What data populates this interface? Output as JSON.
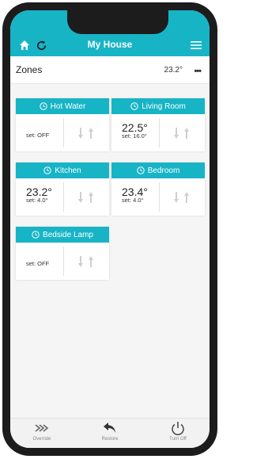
{
  "header": {
    "title": "My House",
    "home_icon": "home-icon",
    "refresh_icon": "refresh-icon",
    "menu_icon": "hamburger-menu-icon",
    "accent_color": "#17b4c6"
  },
  "zones_bar": {
    "label": "Zones",
    "temperature": "23.2°",
    "more_icon": "more-dots-icon"
  },
  "zones": [
    {
      "name": "Hot Water",
      "current": "",
      "set": "set: OFF"
    },
    {
      "name": "Living Room",
      "current": "22.5°",
      "set": "set: 16.0°"
    },
    {
      "name": "Kitchen",
      "current": "23.2°",
      "set": "set: 4.0°"
    },
    {
      "name": "Bedroom",
      "current": "23.4°",
      "set": "set: 4.0°"
    },
    {
      "name": "Bedside Lamp",
      "current": "",
      "set": "set: OFF"
    }
  ],
  "bottom_bar": {
    "override": "Override",
    "restore": "Restore",
    "turn_off": "Turn Off"
  }
}
